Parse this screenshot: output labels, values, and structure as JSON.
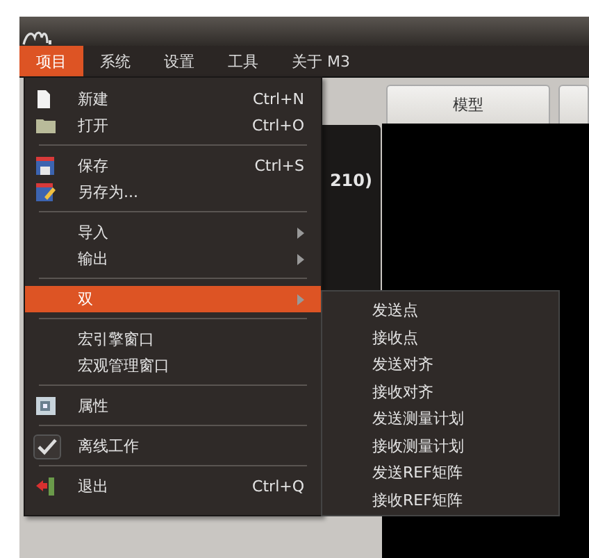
{
  "menubar": [
    {
      "label": "项目",
      "selected": true
    },
    {
      "label": "系统",
      "selected": false
    },
    {
      "label": "设置",
      "selected": false
    },
    {
      "label": "工具",
      "selected": false
    },
    {
      "label": "关于 M3",
      "selected": false
    }
  ],
  "tabs": [
    "模型"
  ],
  "side_text": "210)",
  "menu": [
    {
      "kind": "item",
      "label": "新建",
      "shortcut": "Ctrl+N"
    },
    {
      "kind": "item",
      "label": "打开",
      "shortcut": "Ctrl+O"
    },
    {
      "kind": "separator"
    },
    {
      "kind": "item",
      "label": "保存",
      "shortcut": "Ctrl+S"
    },
    {
      "kind": "item",
      "label": "另存为..."
    },
    {
      "kind": "separator"
    },
    {
      "kind": "submenu",
      "label": "导入",
      "selected": false
    },
    {
      "kind": "submenu",
      "label": "输出",
      "selected": false
    },
    {
      "kind": "separator"
    },
    {
      "kind": "submenu",
      "label": "双",
      "selected": true
    },
    {
      "kind": "separator"
    },
    {
      "kind": "item",
      "label": "宏引擎窗口"
    },
    {
      "kind": "item",
      "label": "宏观管理窗口"
    },
    {
      "kind": "separator"
    },
    {
      "kind": "item",
      "label": "属性"
    },
    {
      "kind": "separator"
    },
    {
      "kind": "check",
      "label": "离线工作",
      "checked": true
    },
    {
      "kind": "separator"
    },
    {
      "kind": "item",
      "label": "退出",
      "shortcut": "Ctrl+Q"
    }
  ],
  "submenu": [
    "发送点",
    "接收点",
    "发送对齐",
    "接收对齐",
    "发送测量计划",
    "接收测量计划",
    "发送REF矩阵",
    "接收REF矩阵"
  ]
}
